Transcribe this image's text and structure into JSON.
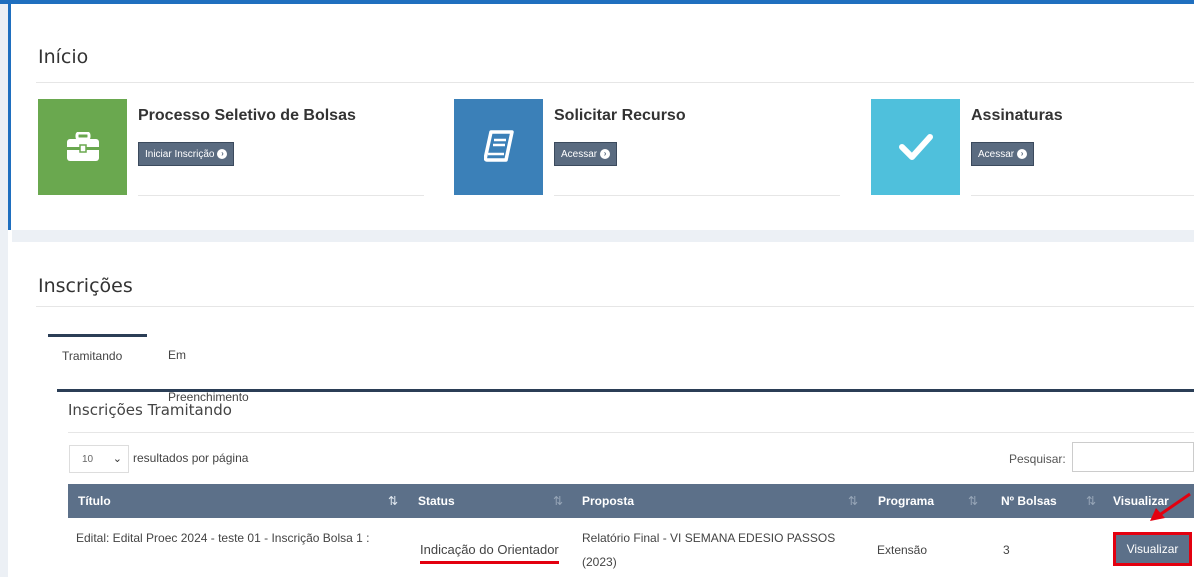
{
  "inicio": {
    "title": "Início",
    "cards": [
      {
        "title": "Processo Seletivo de Bolsas",
        "button": "Iniciar Inscrição",
        "icon": "briefcase-icon",
        "color": "#6aa84f"
      },
      {
        "title": "Solicitar Recurso",
        "button": "Acessar",
        "icon": "book-icon",
        "color": "#3b80b8"
      },
      {
        "title": "Assinaturas",
        "button": "Acessar",
        "icon": "check-icon",
        "color": "#4fc0dc"
      }
    ]
  },
  "inscricoes": {
    "title": "Inscrições",
    "tabs": [
      {
        "label": "Tramitando",
        "active": true
      },
      {
        "label": "Em Preenchimento",
        "active": false
      }
    ],
    "panel_title": "Inscrições Tramitando",
    "page_size": "10",
    "per_page_label": "resultados por página",
    "search_label": "Pesquisar:",
    "search_value": "",
    "columns": [
      "Título",
      "Status",
      "Proposta",
      "Programa",
      "Nº Bolsas",
      "Visualizar"
    ],
    "rows": [
      {
        "titulo": "Edital: Edital Proec 2024 - teste 01 - Inscrição Bolsa 1 :",
        "status": "Indicação do Orientador",
        "proposta_line1": "Relatório Final - VI SEMANA EDESIO PASSOS",
        "proposta_line2": "(2023)",
        "programa": "Extensão",
        "bolsas": "3",
        "action": "Visualizar"
      }
    ]
  },
  "colors": {
    "accent": "#1f6fbf",
    "header": "#5c7089",
    "button": "#5a6b80",
    "highlight": "#e3000f"
  }
}
